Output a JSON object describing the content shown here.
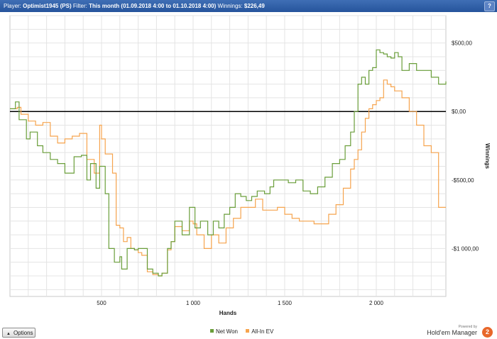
{
  "header": {
    "player_label": "Player:",
    "player_value": "Optimist1945 (PS)",
    "filter_label": "Filter:",
    "filter_value": "This month (01.09.2018 4:00 to 01.10.2018 4:00)",
    "winnings_label": "Winnings:",
    "winnings_value": "$226,49",
    "help_icon": "question-icon"
  },
  "options_label": "Options",
  "brand": {
    "small": "Powered by",
    "name": "Hold'em Manager",
    "logo": "2"
  },
  "colors": {
    "net_won": "#6a9e3a",
    "all_in_ev": "#f6a44e",
    "zero_line": "#000000",
    "grid": "#e4e4e4"
  },
  "chart_data": {
    "type": "line",
    "xlabel": "Hands",
    "ylabel": "Winnings",
    "xlim": [
      0,
      2380
    ],
    "ylim": [
      -1350,
      700
    ],
    "x_ticks": [
      500,
      1000,
      1500,
      2000
    ],
    "x_tick_labels": [
      "500",
      "1 000",
      "1 500",
      "2 000"
    ],
    "y_ticks": [
      500,
      0,
      -500,
      -1000
    ],
    "y_tick_labels": [
      "$500,00",
      "$0,00",
      "-$500,00",
      "-$1 000,00"
    ],
    "grid": true,
    "legend_position": "bottom",
    "series": [
      {
        "name": "Net Won",
        "color": "#6a9e3a",
        "x": [
          0,
          30,
          50,
          90,
          110,
          150,
          180,
          220,
          260,
          300,
          350,
          390,
          420,
          440,
          470,
          490,
          520,
          540,
          570,
          600,
          610,
          640,
          680,
          700,
          720,
          750,
          780,
          810,
          830,
          860,
          880,
          900,
          940,
          980,
          1010,
          1040,
          1080,
          1110,
          1140,
          1170,
          1200,
          1230,
          1260,
          1290,
          1320,
          1350,
          1390,
          1420,
          1440,
          1480,
          1520,
          1560,
          1600,
          1640,
          1680,
          1720,
          1760,
          1800,
          1830,
          1860,
          1880,
          1900,
          1920,
          1940,
          1960,
          1980,
          2000,
          2020,
          2040,
          2060,
          2080,
          2100,
          2120,
          2140,
          2180,
          2220,
          2260,
          2300,
          2340,
          2380
        ],
        "y": [
          20,
          70,
          -60,
          -200,
          -150,
          -250,
          -300,
          -350,
          -380,
          -450,
          -330,
          -320,
          -500,
          -380,
          -560,
          -400,
          -600,
          -1000,
          -1100,
          -1060,
          -1150,
          -1000,
          -1010,
          -1000,
          -1000,
          -1150,
          -1180,
          -1200,
          -1180,
          -1000,
          -950,
          -800,
          -900,
          -700,
          -850,
          -800,
          -900,
          -800,
          -850,
          -750,
          -700,
          -600,
          -620,
          -650,
          -620,
          -580,
          -600,
          -550,
          -500,
          -500,
          -520,
          -500,
          -580,
          -600,
          -550,
          -480,
          -380,
          -350,
          -250,
          -150,
          0,
          200,
          250,
          200,
          300,
          320,
          450,
          430,
          420,
          400,
          390,
          430,
          400,
          300,
          350,
          300,
          300,
          250,
          200,
          220
        ]
      },
      {
        "name": "All-In EV",
        "color": "#f6a44e",
        "x": [
          0,
          40,
          60,
          100,
          140,
          180,
          220,
          260,
          300,
          340,
          380,
          420,
          460,
          490,
          500,
          520,
          560,
          580,
          600,
          620,
          640,
          660,
          680,
          700,
          720,
          750,
          780,
          810,
          830,
          860,
          880,
          900,
          940,
          980,
          1000,
          1020,
          1060,
          1100,
          1140,
          1180,
          1220,
          1260,
          1300,
          1340,
          1380,
          1420,
          1460,
          1500,
          1540,
          1580,
          1620,
          1660,
          1700,
          1740,
          1780,
          1820,
          1860,
          1880,
          1900,
          1920,
          1940,
          1960,
          1980,
          2000,
          2020,
          2040,
          2060,
          2080,
          2100,
          2140,
          2180,
          2220,
          2260,
          2300,
          2340,
          2380
        ],
        "y": [
          20,
          30,
          -20,
          -70,
          -100,
          -80,
          -180,
          -230,
          -200,
          -180,
          -160,
          -350,
          -450,
          -100,
          -200,
          -310,
          -450,
          -830,
          -850,
          -950,
          -920,
          -1000,
          -1010,
          -1030,
          -1050,
          -1170,
          -1190,
          -1200,
          -1180,
          -1010,
          -950,
          -840,
          -870,
          -800,
          -820,
          -900,
          -1000,
          -900,
          -960,
          -850,
          -780,
          -700,
          -700,
          -640,
          -720,
          -720,
          -700,
          -750,
          -780,
          -800,
          -800,
          -820,
          -820,
          -750,
          -680,
          -560,
          -420,
          -350,
          -280,
          -150,
          -50,
          20,
          50,
          80,
          100,
          230,
          200,
          180,
          150,
          100,
          0,
          -100,
          -250,
          -300,
          -700,
          -700
        ]
      }
    ]
  }
}
